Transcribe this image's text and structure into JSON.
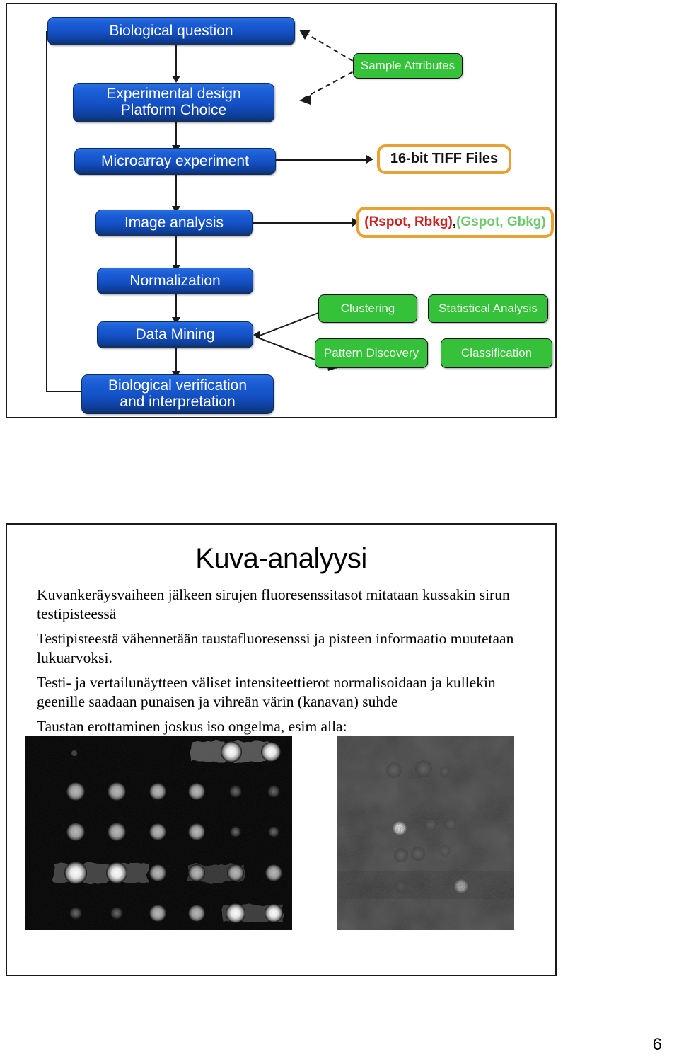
{
  "page": {
    "number": "6"
  },
  "flowchart": {
    "nodes": [
      {
        "id": "biological-question",
        "label": "Biological question",
        "color": "blue"
      },
      {
        "id": "experimental-design",
        "label": "Experimental design\nPlatform Choice",
        "color": "blue"
      },
      {
        "id": "microarray-experiment",
        "label": "Microarray experiment",
        "color": "blue"
      },
      {
        "id": "image-analysis",
        "label": "Image analysis",
        "color": "blue"
      },
      {
        "id": "normalization",
        "label": "Normalization",
        "color": "blue"
      },
      {
        "id": "data-mining",
        "label": "Data Mining",
        "color": "blue"
      },
      {
        "id": "biological-verification",
        "label": "Biological verification\nand interpretation",
        "color": "blue"
      },
      {
        "id": "sample-attributes",
        "label": "Sample Attributes",
        "color": "green"
      },
      {
        "id": "clustering",
        "label": "Clustering",
        "color": "green"
      },
      {
        "id": "statistical-analysis",
        "label": "Statistical Analysis",
        "color": "green"
      },
      {
        "id": "pattern-discovery",
        "label": "Pattern Discovery",
        "color": "green"
      },
      {
        "id": "classification",
        "label": "Classification",
        "color": "green"
      },
      {
        "id": "tiff-files",
        "label": "16-bit TIFF Files",
        "color": "orange"
      }
    ],
    "spot_values": {
      "red_part": "(Rspot, Rbkg)",
      "separator": ",",
      "green_part": " (Gspot, Gbkg)"
    },
    "colors": {
      "blue_top": "#2a6fe0",
      "blue_bottom": "#12305f",
      "green": "#35c23a",
      "orange_border": "#e8a233",
      "red_text": "#cc2222",
      "green_text": "#6ec96e",
      "connector": "#1a1a1a"
    }
  },
  "slide": {
    "title": "Kuva-analyysi",
    "paragraphs": [
      "Kuvankeräysvaiheen jälkeen sirujen fluoresenssitasot mitataan kussakin sirun testipisteessä",
      "Testipisteestä vähennetään taustafluoresenssi ja pisteen informaatio muutetaan lukuarvoksi.",
      "Testi- ja vertailunäytteen väliset intensiteettierot normalisoidaan ja kullekin geenille saadaan punaisen ja vihreän värin (kanavan) suhde",
      "Taustan erottaminen joskus iso ongelma, esim alla:"
    ]
  },
  "images": {
    "left_caption": "microarray-clean-spots",
    "right_caption": "microarray-noisy-background"
  }
}
